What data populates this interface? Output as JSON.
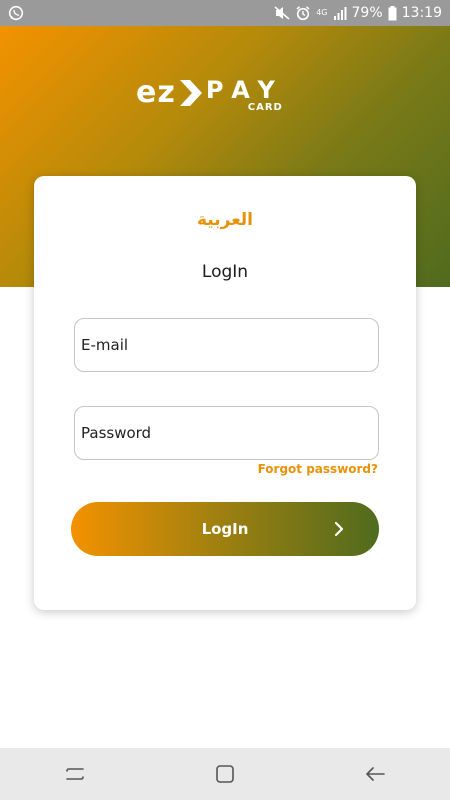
{
  "status_bar": {
    "notification_icon": "whatsapp-icon",
    "network_type": "4G",
    "battery_percent": "79%",
    "time": "13:19"
  },
  "brand": {
    "logo_primary": "ez",
    "logo_secondary": "PAY",
    "logo_tertiary": "CARD"
  },
  "login_card": {
    "language_toggle": "العربية",
    "title": "LogIn",
    "email_placeholder": "E-mail",
    "password_placeholder": "Password",
    "forgot_password": "Forgot password?",
    "login_button": "LogIn"
  },
  "colors": {
    "accent_orange": "#f39200",
    "accent_green": "#4f6b1e",
    "link_color": "#e8920a"
  },
  "nav_bar": {
    "icons": [
      "recent-apps-icon",
      "home-icon",
      "back-icon"
    ]
  }
}
